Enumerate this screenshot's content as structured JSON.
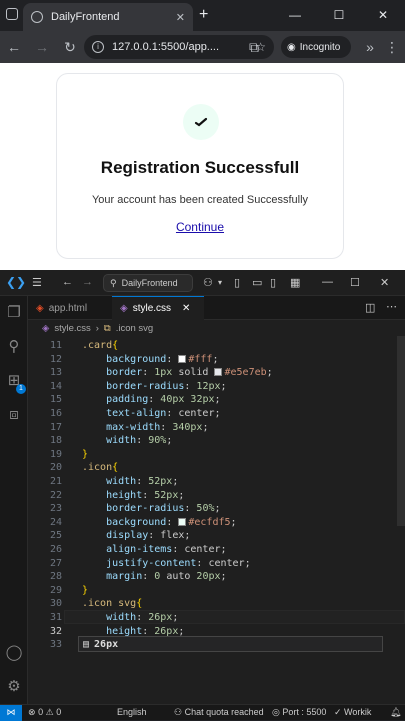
{
  "browser": {
    "tab_title": "DailyFrontend",
    "url": "127.0.0.1:5500/app....",
    "incognito_label": "Incognito"
  },
  "page": {
    "title": "Registration Successfull",
    "message": "Your account has been created Successfully",
    "link": "Continue",
    "colors": {
      "icon_bg": "#ecfdf5",
      "card_border": "#e5e7eb"
    }
  },
  "vscode": {
    "search": "DailyFrontend",
    "tabs": [
      {
        "label": "app.html",
        "icon": "html-file-icon"
      },
      {
        "label": "style.css",
        "icon": "css-file-icon"
      }
    ],
    "breadcrumb": {
      "file": "style.css",
      "symbol": ".icon svg"
    },
    "lines": [
      {
        "n": "11",
        "t": ".card{"
      },
      {
        "n": "12",
        "t": "    background: #fff;"
      },
      {
        "n": "13",
        "t": "    border: 1px solid #e5e7eb;"
      },
      {
        "n": "14",
        "t": "    border-radius: 12px;"
      },
      {
        "n": "15",
        "t": "    padding: 40px 32px;"
      },
      {
        "n": "16",
        "t": "    text-align: center;"
      },
      {
        "n": "17",
        "t": "    max-width: 340px;"
      },
      {
        "n": "18",
        "t": "    width: 90%;"
      },
      {
        "n": "19",
        "t": "}"
      },
      {
        "n": "20",
        "t": ".icon{"
      },
      {
        "n": "21",
        "t": "    width: 52px;"
      },
      {
        "n": "22",
        "t": "    height: 52px;"
      },
      {
        "n": "23",
        "t": "    border-radius: 50%;"
      },
      {
        "n": "24",
        "t": "    background: #ecfdf5;"
      },
      {
        "n": "25",
        "t": "    display: flex;"
      },
      {
        "n": "26",
        "t": "    align-items: center;"
      },
      {
        "n": "27",
        "t": "    justify-content: center;"
      },
      {
        "n": "28",
        "t": "    margin: 0 auto 20px;"
      },
      {
        "n": "29",
        "t": "}"
      },
      {
        "n": "30",
        "t": ".icon svg{"
      },
      {
        "n": "31",
        "t": "    width: 26px;"
      },
      {
        "n": "32",
        "t": "    height: 26px;"
      },
      {
        "n": "33",
        "t": ""
      }
    ],
    "suggestion": "26px",
    "status": {
      "errors": "0",
      "warnings": "0",
      "language": "English",
      "chat": "Chat quota reached",
      "port": "Port : 5500",
      "workik": "Workik"
    }
  }
}
